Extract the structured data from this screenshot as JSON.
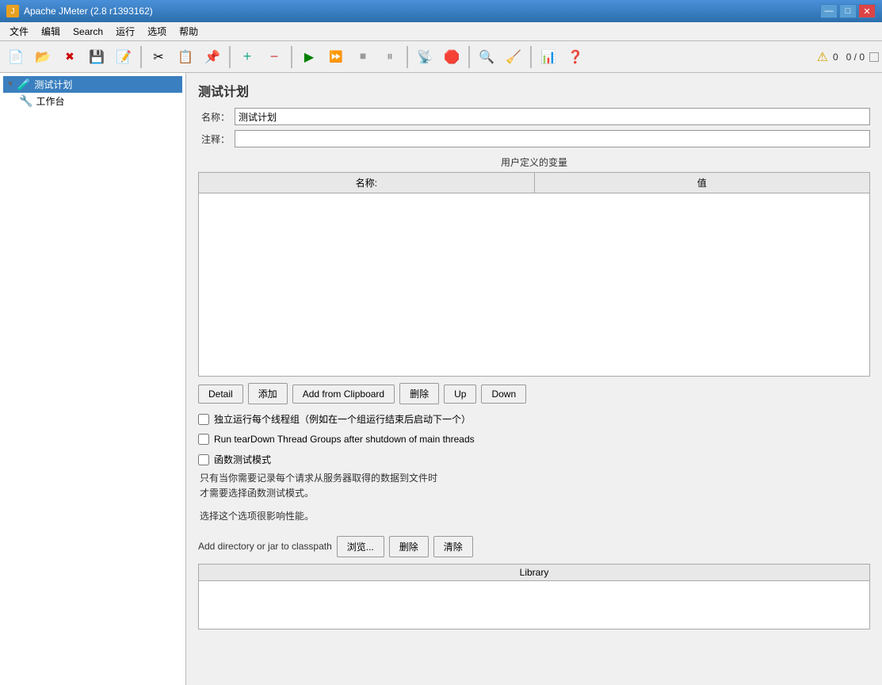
{
  "titlebar": {
    "icon": "J",
    "text": "Apache JMeter (2.8 r1393162)",
    "minimize": "—",
    "maximize": "□",
    "close": "✕"
  },
  "menubar": {
    "items": [
      "文件",
      "编辑",
      "Search",
      "运行",
      "选项",
      "帮助"
    ]
  },
  "toolbar": {
    "buttons": [
      {
        "name": "new-btn",
        "icon": "📄"
      },
      {
        "name": "open-btn",
        "icon": "📂"
      },
      {
        "name": "close-btn",
        "icon": "✖"
      },
      {
        "name": "save-btn",
        "icon": "💾"
      },
      {
        "name": "saveas-btn",
        "icon": "📝"
      },
      {
        "name": "cut-btn",
        "icon": "✂"
      },
      {
        "name": "copy-btn",
        "icon": "📋"
      },
      {
        "name": "paste-btn",
        "icon": "📌"
      },
      {
        "name": "add-btn",
        "icon": "➕"
      },
      {
        "name": "remove-btn",
        "icon": "➖"
      },
      {
        "name": "start-btn",
        "icon": "▶"
      },
      {
        "name": "start-nopauses-btn",
        "icon": "⏩"
      },
      {
        "name": "start-nodep-btn",
        "icon": "⏭"
      },
      {
        "name": "stop-btn",
        "icon": "⏹"
      },
      {
        "name": "shutdown-btn",
        "icon": "⏸"
      },
      {
        "name": "remote-start-btn",
        "icon": "📡"
      },
      {
        "name": "remote-stop-btn",
        "icon": "📵"
      },
      {
        "name": "remote-exit-btn",
        "icon": "🔌"
      },
      {
        "name": "search-btn",
        "icon": "🔍"
      },
      {
        "name": "clear-btn",
        "icon": "🧹"
      },
      {
        "name": "help-btn",
        "icon": "❓"
      },
      {
        "name": "template-btn",
        "icon": "📊"
      },
      {
        "name": "options-btn",
        "icon": "⚙"
      }
    ],
    "warning_count": "0",
    "warning_icon": "⚠",
    "error_count": "0 / 0"
  },
  "sidebar": {
    "items": [
      {
        "label": "测试计划",
        "icon": "🧪",
        "selected": true
      },
      {
        "label": "工作台",
        "icon": "🔧",
        "selected": false
      }
    ]
  },
  "content": {
    "title": "测试计划",
    "name_label": "名称：",
    "name_value": "测试计划",
    "comment_label": "注释：",
    "comment_value": "",
    "vars_section_title": "用户定义的变量",
    "vars_table": {
      "col_name": "名称:",
      "col_value": "值",
      "rows": []
    },
    "buttons": {
      "detail": "Detail",
      "add": "添加",
      "add_from_clipboard": "Add from Clipboard",
      "delete": "删除",
      "up": "Up",
      "down": "Down"
    },
    "checkbox1_label": "独立运行每个线程组（例如在一个组运行结束后启动下一个）",
    "checkbox2_label": "Run tearDown Thread Groups after shutdown of main threads",
    "checkbox3_label": "函数测试模式",
    "desc_line1": "只有当你需要记录每个请求从服务器取得的数据到文件时",
    "desc_line2": "才需要选择函数测试模式。",
    "desc_line3": "",
    "desc_line4": "选择这个选项很影响性能。",
    "classpath_label": "Add directory or jar to classpath",
    "browse_btn": "浏览...",
    "delete_classpath_btn": "删除",
    "clear_classpath_btn": "清除",
    "library_header": "Library"
  }
}
